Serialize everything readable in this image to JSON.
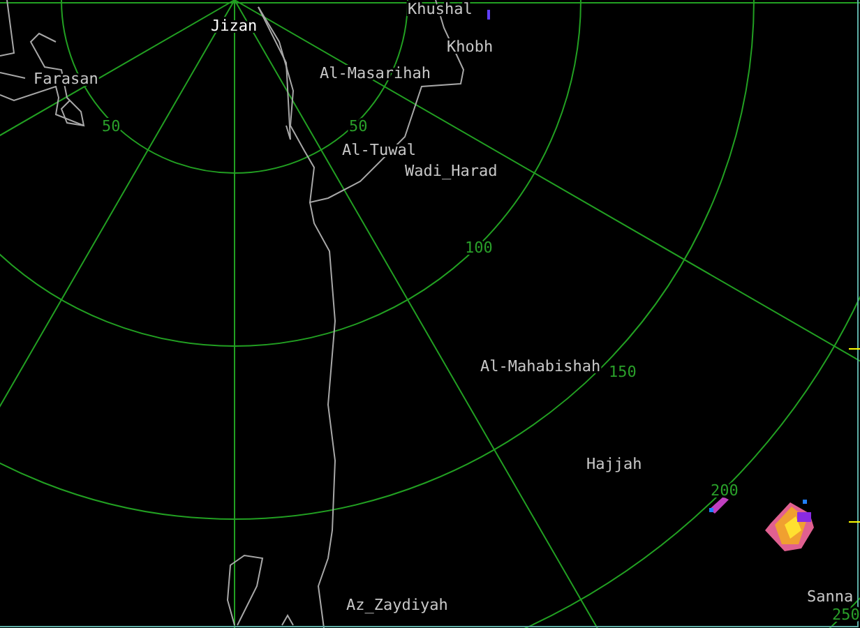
{
  "radar_map": {
    "station": {
      "label": "Jizan"
    },
    "places": [
      {
        "label": "Khushal"
      },
      {
        "label": "Khobh"
      },
      {
        "label": "Farasan"
      },
      {
        "label": "Al-Masarihah"
      },
      {
        "label": "Al-Tuwal"
      },
      {
        "label": "Wadi_Harad"
      },
      {
        "label": "Al-Mahabishah"
      },
      {
        "label": "Hajjah"
      },
      {
        "label": "Az_Zaydiyah"
      },
      {
        "label": "Sanna"
      }
    ],
    "range_labels": [
      {
        "label": "50"
      },
      {
        "label": "50"
      },
      {
        "label": "100"
      },
      {
        "label": "150"
      },
      {
        "label": "200"
      },
      {
        "label": "250"
      }
    ]
  }
}
